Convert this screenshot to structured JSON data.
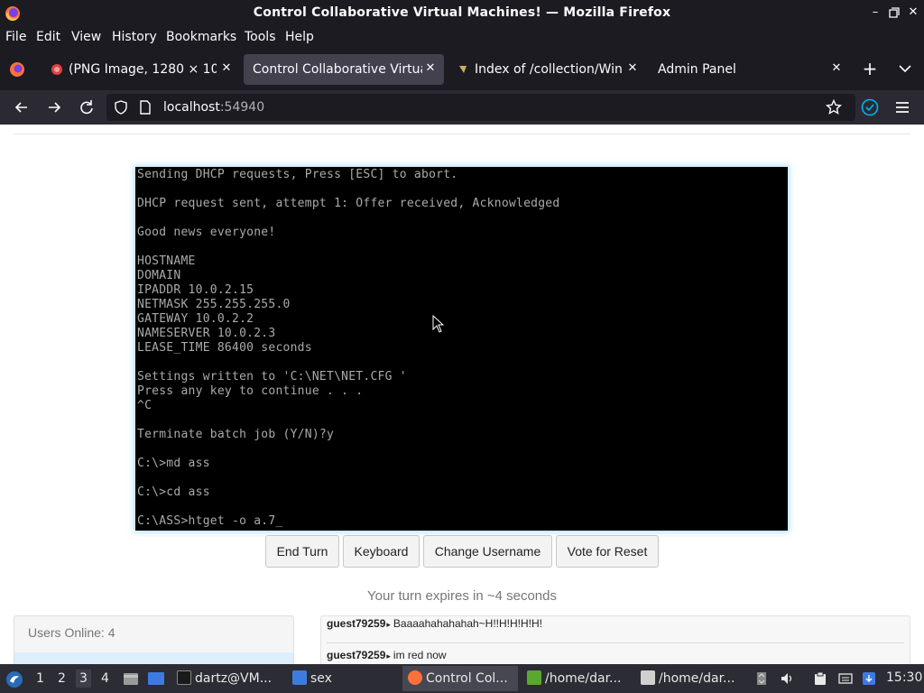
{
  "window": {
    "title": "Control Collaborative Virtual Machines! — Mozilla Firefox",
    "controls": [
      "minimize-icon",
      "restore-icon",
      "close-icon"
    ]
  },
  "menu": {
    "items": [
      {
        "label": "File",
        "accel": "F"
      },
      {
        "label": "Edit",
        "accel": "E"
      },
      {
        "label": "View",
        "accel": "V"
      },
      {
        "label": "History",
        "accel": "H"
      },
      {
        "label": "Bookmarks",
        "accel": "B"
      },
      {
        "label": "Tools",
        "accel": "T"
      },
      {
        "label": "Help",
        "accel": "H"
      }
    ]
  },
  "tabs": [
    {
      "label": "(PNG Image, 1280 × 1024 pixels)",
      "icon": "image-favicon",
      "active": false
    },
    {
      "label": "Control Collaborative Virtual Machines!",
      "icon": "none",
      "active": true
    },
    {
      "label": "Index of /collection/Windows",
      "icon": "folder-favicon",
      "active": false
    },
    {
      "label": "Admin Panel",
      "icon": "none",
      "active": false
    }
  ],
  "navbar": {
    "url_host": "localhost",
    "url_port": ":54940",
    "icons": [
      "back-icon",
      "forward-icon",
      "reload-icon",
      "shield-icon",
      "page-icon",
      "bookmark-star-icon",
      "account-sync-icon",
      "hamburger-menu-icon"
    ]
  },
  "vm_screen": {
    "lines": [
      "Sending DHCP requests, Press [ESC] to abort.",
      "",
      "DHCP request sent, attempt 1: Offer received, Acknowledged",
      "",
      "Good news everyone!",
      "",
      "HOSTNAME",
      "DOMAIN",
      "IPADDR 10.0.2.15",
      "NETMASK 255.255.255.0",
      "GATEWAY 10.0.2.2",
      "NAMESERVER 10.0.2.3",
      "LEASE_TIME 86400 seconds",
      "",
      "Settings written to 'C:\\NET\\NET.CFG '",
      "Press any key to continue . . .",
      "^C",
      "",
      "Terminate batch job (Y/N)?y",
      "",
      "C:\\>md ass",
      "",
      "C:\\>cd ass",
      "",
      "C:\\ASS>htget -o a.7_"
    ]
  },
  "controls": {
    "end_turn": "End Turn",
    "keyboard": "Keyboard",
    "change_username": "Change Username",
    "vote_reset": "Vote for Reset"
  },
  "turn_message": "Your turn expires in ~4 seconds",
  "users_panel": {
    "heading": "Users Online: 4"
  },
  "chat": [
    {
      "user": "guest79259",
      "text": "Baaaahahahahah~H!!H!H!H!H!"
    },
    {
      "user": "guest79259",
      "text": "im red now"
    }
  ],
  "taskbar": {
    "workspaces": [
      "1",
      "2",
      "3",
      "4"
    ],
    "current_workspace": "3",
    "items": [
      {
        "label": "dartz@VM...",
        "icon": "terminal-icon",
        "active": false
      },
      {
        "label": "sex",
        "icon": "folder-icon",
        "active": false
      },
      {
        "label": "Control Col...",
        "icon": "firefox-icon",
        "active": true
      },
      {
        "label": "/home/dar...",
        "icon": "file-icon",
        "active": false
      },
      {
        "label": "/home/dar...",
        "icon": "text-editor-icon",
        "active": false
      }
    ],
    "clock": "15:30"
  }
}
